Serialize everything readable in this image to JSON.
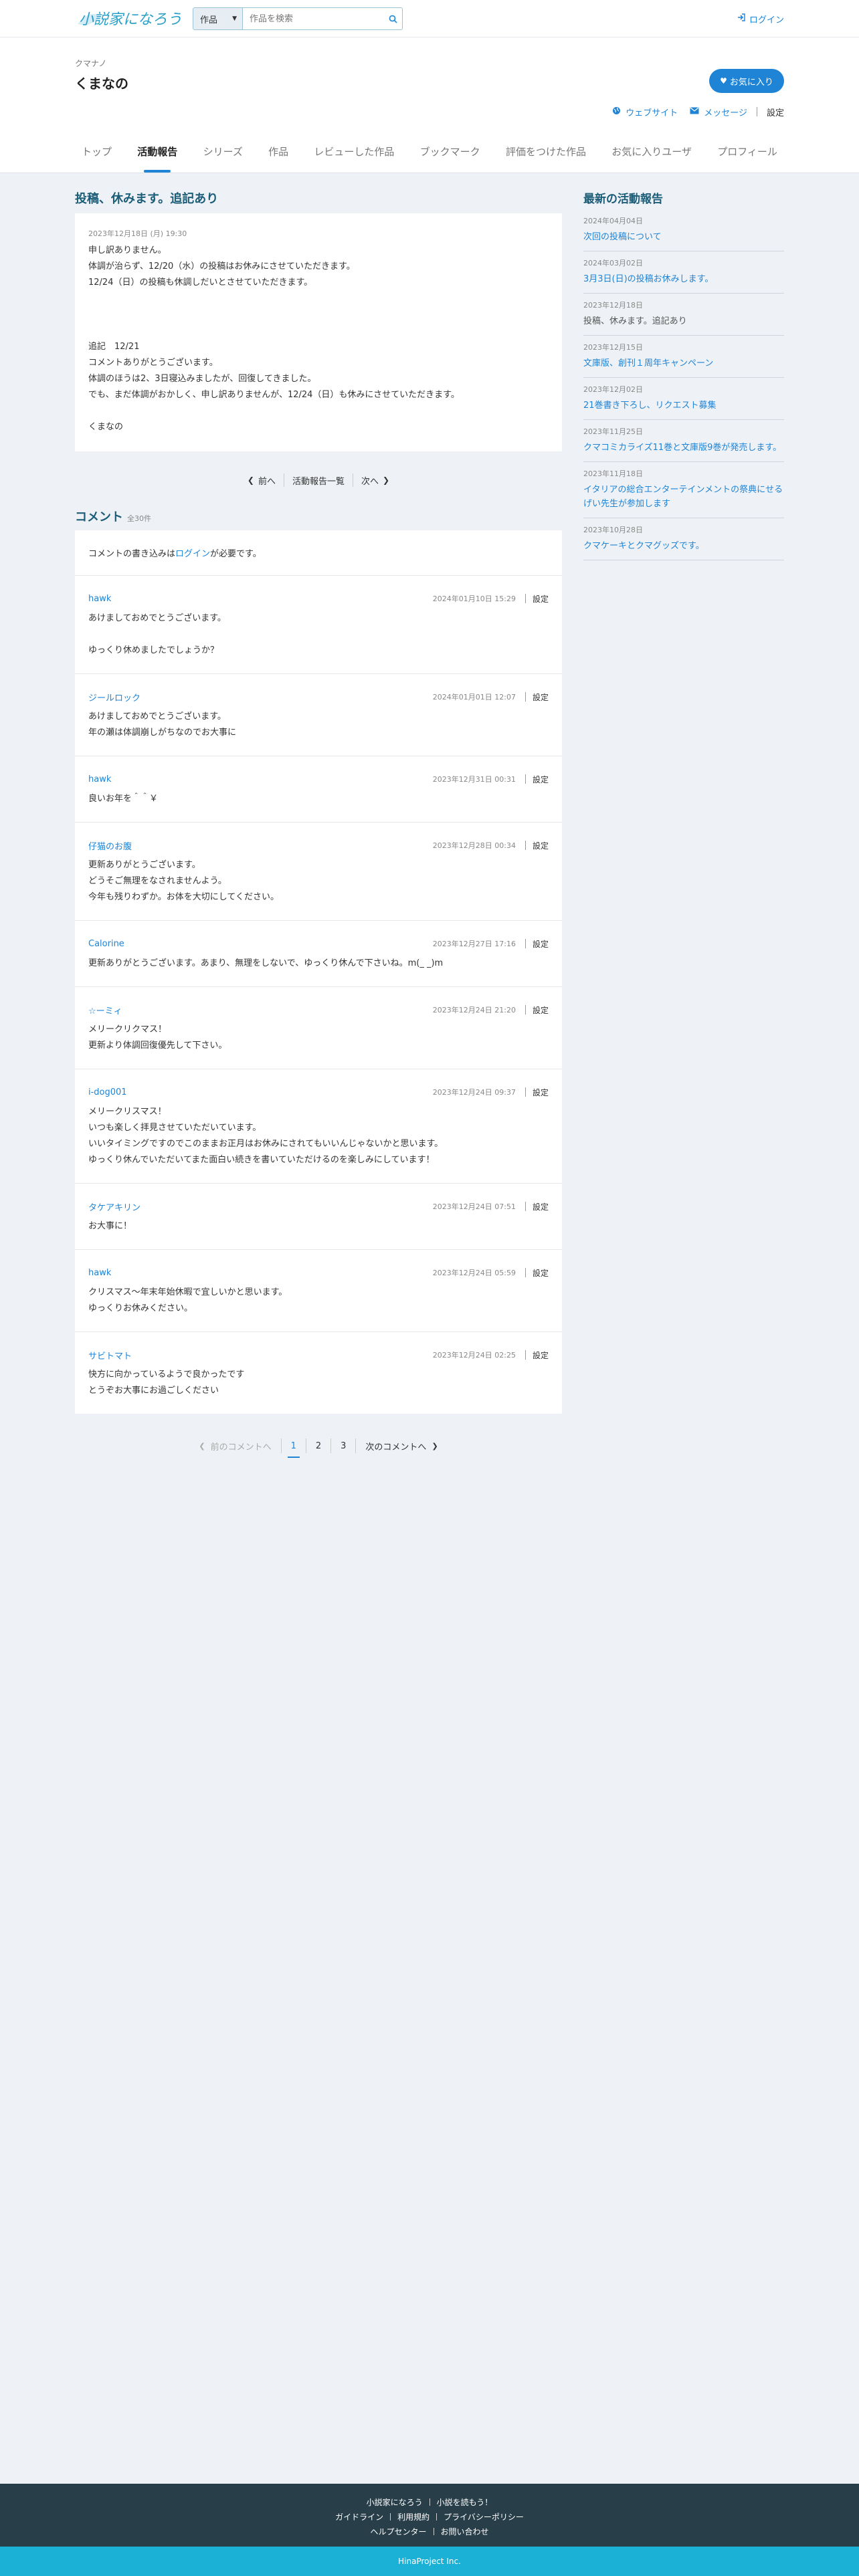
{
  "header": {
    "logo_text": "小説家になろう",
    "search": {
      "category": "作品",
      "placeholder": "作品を検索"
    },
    "login_label": "ログイン"
  },
  "profile": {
    "kana": "クマナノ",
    "name": "くまなの",
    "favorite_button": "お気に入り",
    "links": {
      "website": "ウェブサイト",
      "message": "メッセージ",
      "setting": "設定"
    },
    "tabs": [
      "トップ",
      "活動報告",
      "シリーズ",
      "作品",
      "レビューした作品",
      "ブックマーク",
      "評価をつけた作品",
      "お気に入りユーザ",
      "プロフィール"
    ],
    "active_tab": 1
  },
  "post": {
    "title": "投稿、休みます。追記あり",
    "date": "2023年12月18日 (月) 19:30",
    "lines": [
      "申し訳ありません。",
      "体調が治らず、12/20（水）の投稿はお休みにさせていただきます。",
      "12/24（日）の投稿も休調しだいとさせていただきます。",
      "",
      "",
      "",
      "追記　12/21",
      "コメントありがとうございます。",
      "体調のほうは2、3日寝込みましたが、回復してきました。",
      "でも、まだ体調がおかしく、申し訳ありませんが、12/24（日）も休みにさせていただきます。",
      "",
      "くまなの"
    ]
  },
  "post_pager": {
    "prev": "前へ",
    "list": "活動報告一覧",
    "next": "次へ"
  },
  "comments": {
    "title": "コメント",
    "count": "全30件",
    "login_note_pre": "コメントの書き込みは",
    "login_note_link": "ログイン",
    "login_note_post": "が必要です。",
    "setting_label": "設定",
    "items": [
      {
        "user": "hawk",
        "date": "2024年01月10日 15:29",
        "lines": [
          "あけましておめでとうございます。",
          "",
          "ゆっくり休めましたでしょうか？"
        ]
      },
      {
        "user": "ジールロック",
        "date": "2024年01月01日 12:07",
        "lines": [
          "あけましておめでとうございます。",
          "年の瀬は体調崩しがちなのでお大事に"
        ]
      },
      {
        "user": "hawk",
        "date": "2023年12月31日 00:31",
        "lines": [
          "良いお年を＾＾￥"
        ]
      },
      {
        "user": "仔猫のお腹",
        "date": "2023年12月28日 00:34",
        "lines": [
          "更新ありがとうございます。",
          "どうそご無理をなされませんよう。",
          "今年も残りわずか。お体を大切にしてください。"
        ]
      },
      {
        "user": "Calorine",
        "date": "2023年12月27日 17:16",
        "lines": [
          "更新ありがとうございます。あまり、無理をしないで、ゆっくり休んで下さいね。m(_ _)m"
        ]
      },
      {
        "user": "☆ーミィ",
        "date": "2023年12月24日 21:20",
        "lines": [
          "メリークリクマス！",
          "更新より体調回復優先して下さい。"
        ]
      },
      {
        "user": "i-dog001",
        "date": "2023年12月24日 09:37",
        "lines": [
          "メリークリスマス！",
          "いつも楽しく拝見させていただいています。",
          "いいタイミングですのでこのままお正月はお休みにされてもいいんじゃないかと思います。",
          "ゆっくり休んでいただいてまた面白い続きを書いていただけるのを楽しみにしています！"
        ]
      },
      {
        "user": "タケアキリン",
        "date": "2023年12月24日 07:51",
        "lines": [
          "お大事に！"
        ]
      },
      {
        "user": "hawk",
        "date": "2023年12月24日 05:59",
        "lines": [
          "クリスマス〜年末年始休暇で宜しいかと思います。",
          "ゆっくりお休みください。"
        ]
      },
      {
        "user": "サビトマト",
        "date": "2023年12月24日 02:25",
        "lines": [
          "快方に向かっているようで良かったです",
          "とうぞお大事にお過ごしください"
        ]
      }
    ]
  },
  "comment_pager": {
    "prev": "前のコメントへ",
    "pages": [
      "1",
      "2",
      "3"
    ],
    "current": 0,
    "next": "次のコメントへ"
  },
  "sidebar": {
    "title": "最新の活動報告",
    "reports": [
      {
        "date": "2024年04月04日",
        "title": "次回の投稿について",
        "is_link": true
      },
      {
        "date": "2024年03月02日",
        "title": "3月3日(日)の投稿お休みします。",
        "is_link": true
      },
      {
        "date": "2023年12月18日",
        "title": "投稿、休みます。追記あり",
        "is_link": false
      },
      {
        "date": "2023年12月15日",
        "title": "文庫版、創刊１周年キャンペーン",
        "is_link": true
      },
      {
        "date": "2023年12月02日",
        "title": "21巻書き下ろし、リクエスト募集",
        "is_link": true
      },
      {
        "date": "2023年11月25日",
        "title": "クマコミカライズ11巻と文庫版9巻が発売します。",
        "is_link": true
      },
      {
        "date": "2023年11月18日",
        "title": "イタリアの総合エンターテインメントの祭典にせるげい先生が参加します",
        "is_link": true
      },
      {
        "date": "2023年10月28日",
        "title": "クマケーキとクマグッズです。",
        "is_link": true
      }
    ]
  },
  "footer": {
    "row1": [
      "小説家になろう",
      "小説を読もう！"
    ],
    "row2": [
      "ガイドライン",
      "利用規約",
      "プライバシーポリシー"
    ],
    "row3": [
      "ヘルプセンター",
      "お問い合わせ"
    ],
    "copyright": "HinaProject Inc."
  },
  "colors": {
    "accent": "#1f84d6",
    "heading": "#1b5d78",
    "footer_dark": "#283f4a",
    "footer_light": "#1bb1d6"
  }
}
